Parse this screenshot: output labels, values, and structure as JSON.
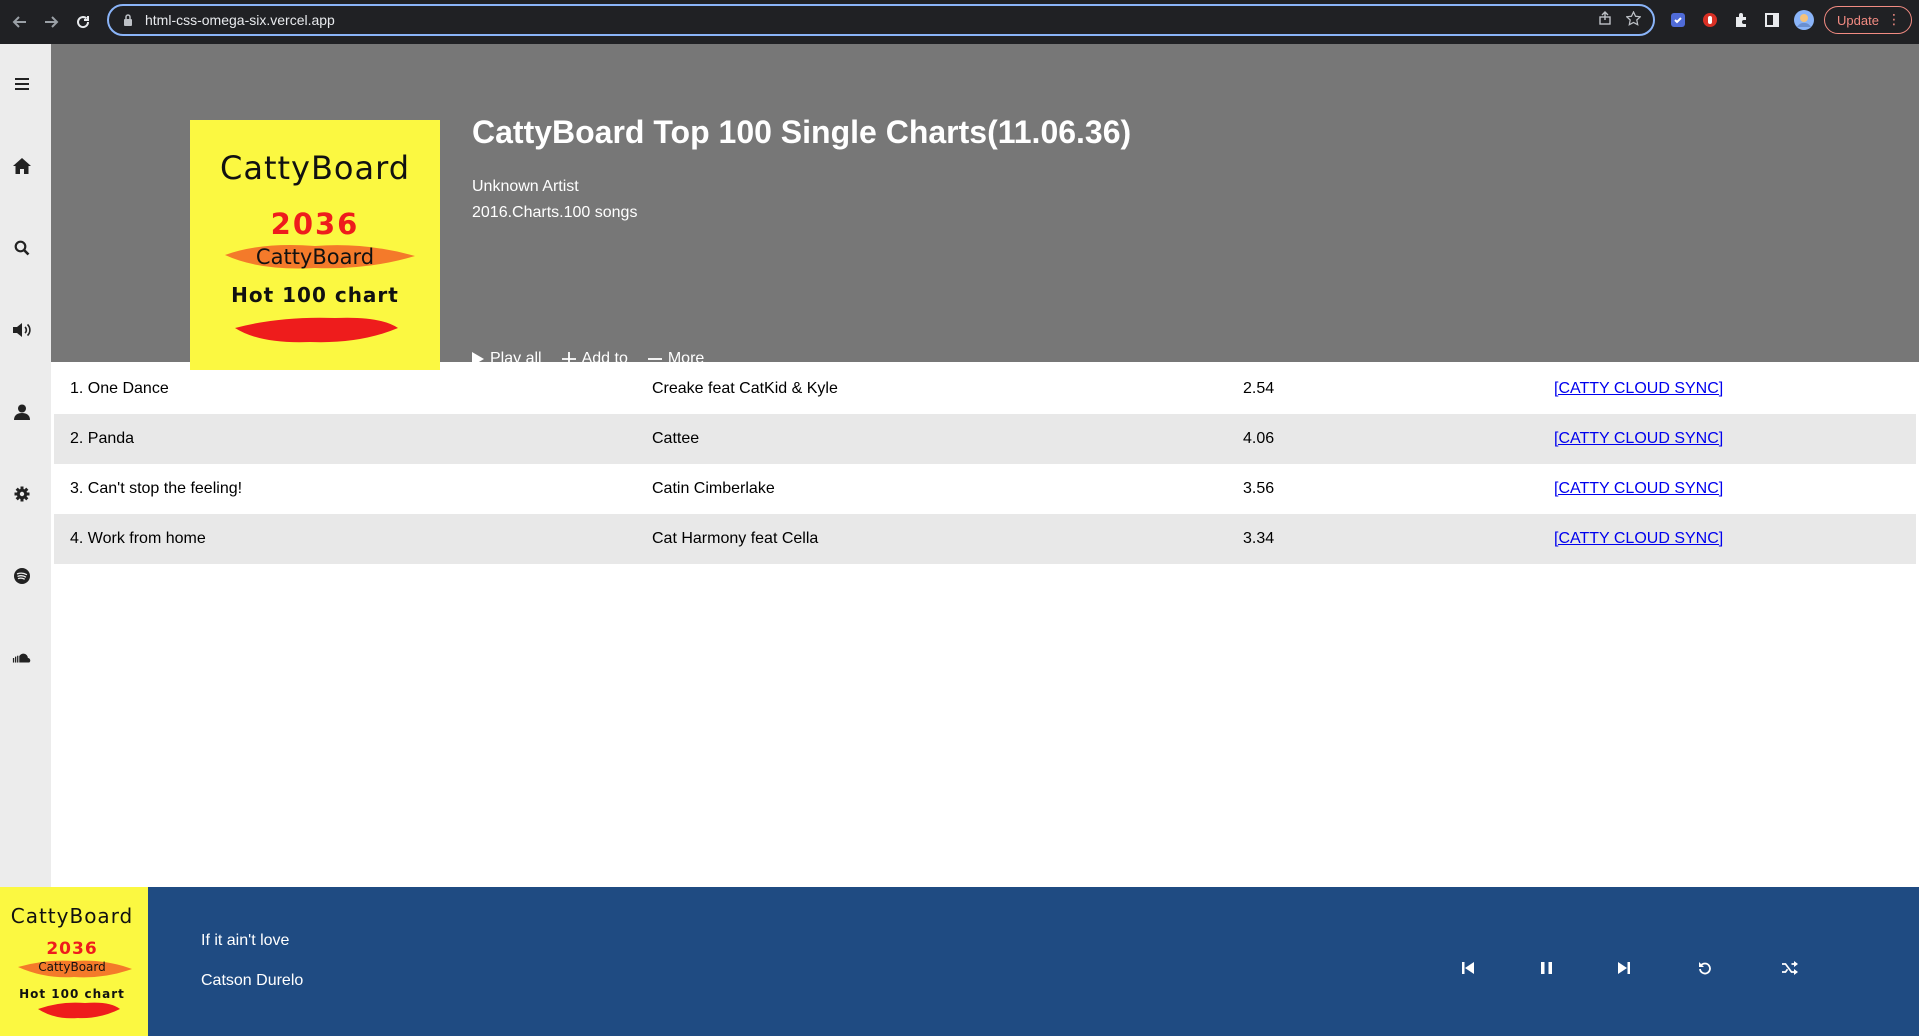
{
  "browser": {
    "url": "html-css-omega-six.vercel.app",
    "update_label": "Update"
  },
  "sidebar": {
    "items": [
      {
        "icon": "menu-icon"
      },
      {
        "icon": "home-icon"
      },
      {
        "icon": "search-icon"
      },
      {
        "icon": "volume-icon"
      },
      {
        "icon": "user-icon"
      },
      {
        "icon": "gear-icon"
      },
      {
        "icon": "spotify-icon"
      },
      {
        "icon": "soundcloud-icon"
      }
    ]
  },
  "album": {
    "cover": {
      "brand": "CattyBoard",
      "year": "2036",
      "sub_brand": "CattyBoard",
      "chart_name": "Hot 100 chart"
    },
    "title": "CattyBoard Top 100 Single Charts(11.06.36)",
    "artist": "Unknown Artist",
    "meta": "2016.Charts.100 songs"
  },
  "actions": {
    "play_all": "Play all",
    "add_to": "Add to",
    "more": "More"
  },
  "tracks": [
    {
      "name": "1. One Dance",
      "artist": "Creake feat CatKid & Kyle",
      "duration": "2.54",
      "link": "[CATTY CLOUD SYNC]"
    },
    {
      "name": "2. Panda",
      "artist": "Cattee",
      "duration": "4.06",
      "link": "[CATTY CLOUD SYNC]"
    },
    {
      "name": "3. Can't stop the feeling!",
      "artist": "Catin Cimberlake",
      "duration": "3.56",
      "link": "[CATTY CLOUD SYNC]"
    },
    {
      "name": "4. Work from home",
      "artist": "Cat Harmony feat Cella",
      "duration": "3.34",
      "link": "[CATTY CLOUD SYNC]"
    }
  ],
  "player": {
    "song": "If it ain't love",
    "artist": "Catson Durelo",
    "cover": {
      "brand": "CattyBoard",
      "year": "2036",
      "sub_brand": "CattyBoard",
      "chart_name": "Hot 100 chart"
    },
    "controls": [
      "previous-icon",
      "pause-icon",
      "next-icon",
      "repeat-icon",
      "shuffle-icon"
    ]
  },
  "colors": {
    "header_bg": "#777777",
    "cover_yellow": "#fbf841",
    "cover_red": "#ee1c1c",
    "cover_orange": "#f47a2a",
    "player_bg": "#1f4b82",
    "row_alt": "#e8e8e8",
    "link": "#0000ee"
  }
}
